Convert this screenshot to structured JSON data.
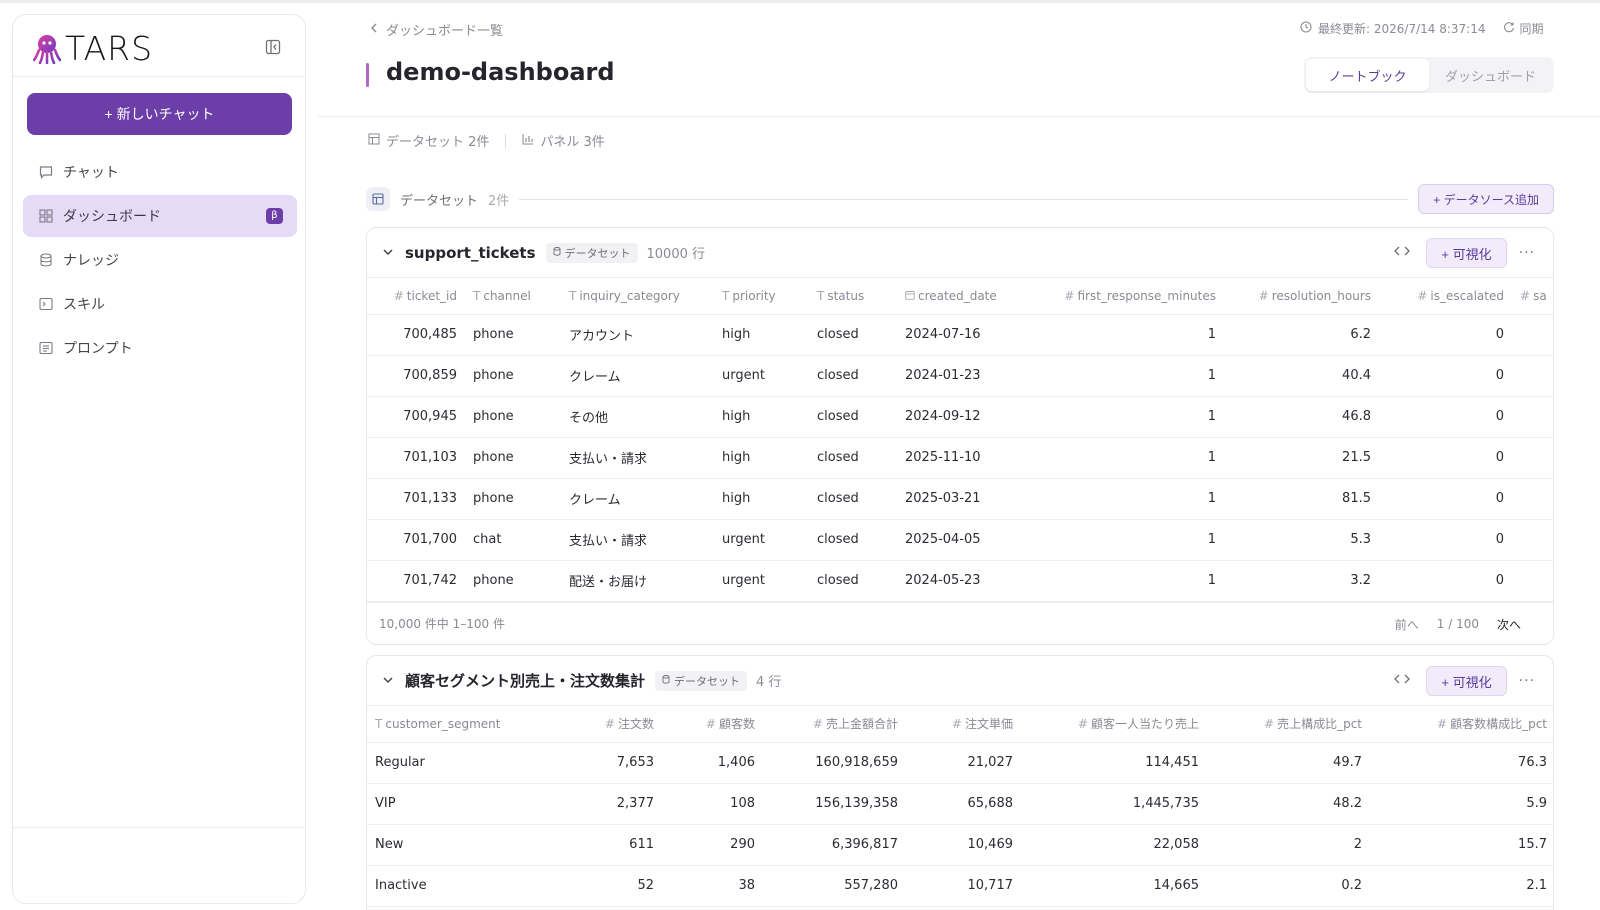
{
  "app": {
    "logo_text": "TARS"
  },
  "sidebar": {
    "new_chat_label": "+ 新しいチャット",
    "items": [
      {
        "label": "チャット",
        "icon": "chat-icon"
      },
      {
        "label": "ダッシュボード",
        "icon": "dashboard-icon",
        "active": true,
        "badge": "β"
      },
      {
        "label": "ナレッジ",
        "icon": "database-icon"
      },
      {
        "label": "スキル",
        "icon": "terminal-icon"
      },
      {
        "label": "プロンプト",
        "icon": "prompt-icon"
      }
    ]
  },
  "header": {
    "breadcrumb": "ダッシュボード一覧",
    "title": "demo-dashboard",
    "last_updated": "最終更新: 2026/7/14 8:37:14",
    "sync_label": "同期",
    "view_options": [
      "ノートブック",
      "ダッシュボード"
    ]
  },
  "summary": {
    "datasets": "データセット 2件",
    "panels": "パネル 3件"
  },
  "datasets_section": {
    "label": "データセット",
    "count": "2件",
    "add_source_label": "+ データソース追加"
  },
  "colors": {
    "accent": "#6c3fa8",
    "active_bg": "#e6dbf6"
  },
  "cards": [
    {
      "name": "support_tickets",
      "tag": "データセット",
      "rows_count": "10000 行",
      "viz_label": "+ 可視化",
      "columns": [
        {
          "type": "#",
          "name": "ticket_id",
          "align": "num"
        },
        {
          "type": "T",
          "name": "channel"
        },
        {
          "type": "T",
          "name": "inquiry_category"
        },
        {
          "type": "T",
          "name": "priority"
        },
        {
          "type": "T",
          "name": "status"
        },
        {
          "type": "date",
          "name": "created_date"
        },
        {
          "type": "#",
          "name": "first_response_minutes",
          "align": "num"
        },
        {
          "type": "#",
          "name": "resolution_hours",
          "align": "num"
        },
        {
          "type": "#",
          "name": "is_escalated",
          "align": "num"
        },
        {
          "type": "#",
          "name": "sa"
        }
      ],
      "rows": [
        [
          "700,485",
          "phone",
          "アカウント",
          "high",
          "closed",
          "2024-07-16",
          "1",
          "6.2",
          "0",
          ""
        ],
        [
          "700,859",
          "phone",
          "クレーム",
          "urgent",
          "closed",
          "2024-01-23",
          "1",
          "40.4",
          "0",
          ""
        ],
        [
          "700,945",
          "phone",
          "その他",
          "high",
          "closed",
          "2024-09-12",
          "1",
          "46.8",
          "0",
          ""
        ],
        [
          "701,103",
          "phone",
          "支払い・請求",
          "high",
          "closed",
          "2025-11-10",
          "1",
          "21.5",
          "0",
          ""
        ],
        [
          "701,133",
          "phone",
          "クレーム",
          "high",
          "closed",
          "2025-03-21",
          "1",
          "81.5",
          "0",
          ""
        ],
        [
          "701,700",
          "chat",
          "支払い・請求",
          "urgent",
          "closed",
          "2025-04-05",
          "1",
          "5.3",
          "0",
          ""
        ],
        [
          "701,742",
          "phone",
          "配送・お届け",
          "urgent",
          "closed",
          "2024-05-23",
          "1",
          "3.2",
          "0",
          ""
        ]
      ],
      "footer": {
        "range": "10,000 件中 1–100 件",
        "prev": "前へ",
        "page": "1 / 100",
        "next": "次へ"
      }
    },
    {
      "name": "顧客セグメント別売上・注文数集計",
      "tag": "データセット",
      "rows_count": "4 行",
      "viz_label": "+ 可視化",
      "columns": [
        {
          "type": "T",
          "name": "customer_segment"
        },
        {
          "type": "#",
          "name": "注文数",
          "align": "num"
        },
        {
          "type": "#",
          "name": "顧客数",
          "align": "num"
        },
        {
          "type": "#",
          "name": "売上金額合計",
          "align": "num"
        },
        {
          "type": "#",
          "name": "注文単価",
          "align": "num"
        },
        {
          "type": "#",
          "name": "顧客一人当たり売上",
          "align": "num"
        },
        {
          "type": "#",
          "name": "売上構成比_pct",
          "align": "num"
        },
        {
          "type": "#",
          "name": "顧客数構成比_pct",
          "align": "num"
        }
      ],
      "rows": [
        [
          "Regular",
          "7,653",
          "1,406",
          "160,918,659",
          "21,027",
          "114,451",
          "49.7",
          "76.3"
        ],
        [
          "VIP",
          "2,377",
          "108",
          "156,139,358",
          "65,688",
          "1,445,735",
          "48.2",
          "5.9"
        ],
        [
          "New",
          "611",
          "290",
          "6,396,817",
          "10,469",
          "22,058",
          "2",
          "15.7"
        ],
        [
          "Inactive",
          "52",
          "38",
          "557,280",
          "10,717",
          "14,665",
          "0.2",
          "2.1"
        ]
      ]
    }
  ]
}
